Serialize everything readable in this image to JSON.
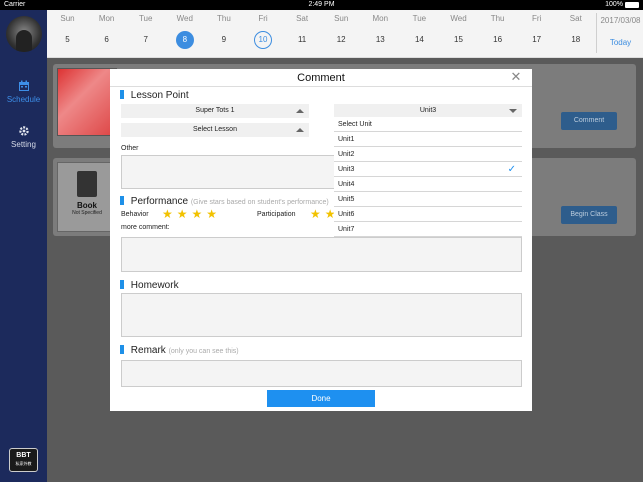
{
  "statusbar": {
    "carrier": "Carrier",
    "time": "2:49 PM",
    "battery": "100%"
  },
  "sidebar": {
    "items": [
      {
        "label": "Schedule",
        "icon": "calendar-icon",
        "active": true
      },
      {
        "label": "Setting",
        "icon": "gear-icon",
        "active": false
      }
    ],
    "logo": {
      "text": "BBT",
      "sub": "私家外教"
    }
  },
  "calendar": {
    "days": [
      {
        "dow": "Sun",
        "num": "5"
      },
      {
        "dow": "Mon",
        "num": "6"
      },
      {
        "dow": "Tue",
        "num": "7"
      },
      {
        "dow": "Wed",
        "num": "8",
        "state": "selected"
      },
      {
        "dow": "Thu",
        "num": "9"
      },
      {
        "dow": "Fri",
        "num": "10",
        "state": "today"
      },
      {
        "dow": "Sat",
        "num": "11"
      },
      {
        "dow": "Sun",
        "num": "12"
      },
      {
        "dow": "Mon",
        "num": "13"
      },
      {
        "dow": "Tue",
        "num": "14"
      },
      {
        "dow": "Wed",
        "num": "15"
      },
      {
        "dow": "Thu",
        "num": "16"
      },
      {
        "dow": "Fri",
        "num": "17"
      },
      {
        "dow": "Sat",
        "num": "18"
      }
    ],
    "current_date": "2017/03/08",
    "today_label": "Today"
  },
  "cards": [
    {
      "button": "Comment"
    },
    {
      "book_label": "Book",
      "book_sub": "Not Specified",
      "button": "Begin Class"
    }
  ],
  "modal": {
    "title": "Comment",
    "lesson_point": {
      "heading": "Lesson Point",
      "course_select": "Super Tots 1",
      "lesson_select": "Select  Lesson",
      "unit_select": "Unit3",
      "other_label": "Other"
    },
    "performance": {
      "heading": "Performance",
      "hint": "(Give stars based on student's performance)",
      "behavior_label": "Behavior",
      "behavior_stars": 4,
      "participation_label": "Participation",
      "participation_stars": 2,
      "more_comment_label": "more comment:"
    },
    "homework": {
      "heading": "Homework"
    },
    "remark": {
      "heading": "Remark",
      "hint": "(only you can see this)"
    },
    "done_label": "Done"
  },
  "unit_dropdown": {
    "items": [
      "Select  Unit",
      "Unit1",
      "Unit2",
      "Unit3",
      "Unit4",
      "Unit5",
      "Unit6",
      "Unit7"
    ],
    "selected": "Unit3"
  },
  "colors": {
    "accent": "#1e90f0",
    "sidebar": "#1c2a5c",
    "star": "#f2c200"
  }
}
